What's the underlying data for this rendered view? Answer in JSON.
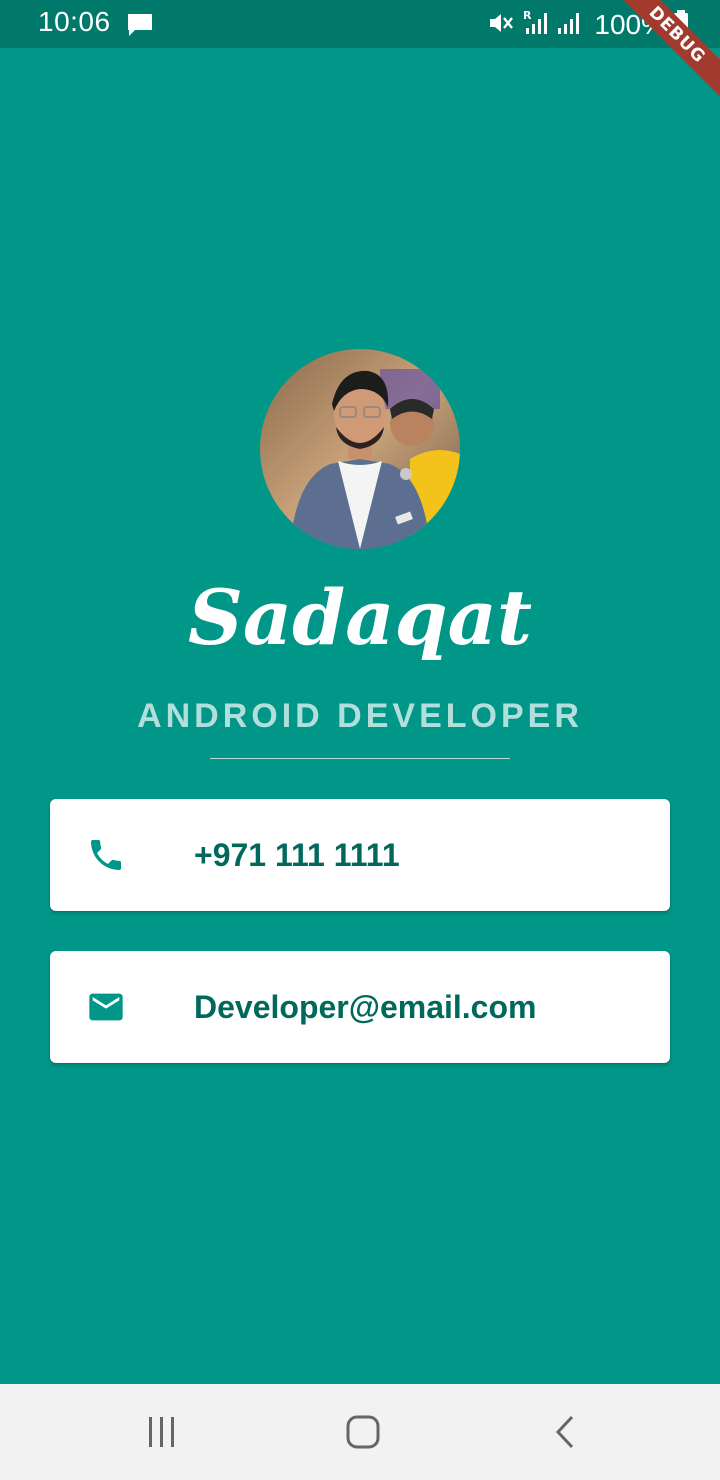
{
  "status_bar": {
    "time": "10:06",
    "battery": "100%",
    "icons": [
      "message-icon",
      "mute-icon",
      "signal-r-icon",
      "signal-icon",
      "battery-icon"
    ]
  },
  "debug_banner": "DEBUG",
  "profile": {
    "name": "Sadaqat",
    "role": "ANDROID DEVELOPER"
  },
  "contacts": {
    "phone": {
      "icon": "phone-icon",
      "text": "+971 111 1111"
    },
    "email": {
      "icon": "mail-icon",
      "text": "Developer@email.com"
    }
  },
  "nav_bar": {
    "icons": [
      "recents-icon",
      "home-icon",
      "back-icon"
    ]
  },
  "colors": {
    "background": "#009688",
    "status_bar": "#00796b",
    "accent_text": "#00695c",
    "subtitle": "#b2dfdb",
    "card": "#ffffff",
    "debug": "#a33a2e"
  }
}
